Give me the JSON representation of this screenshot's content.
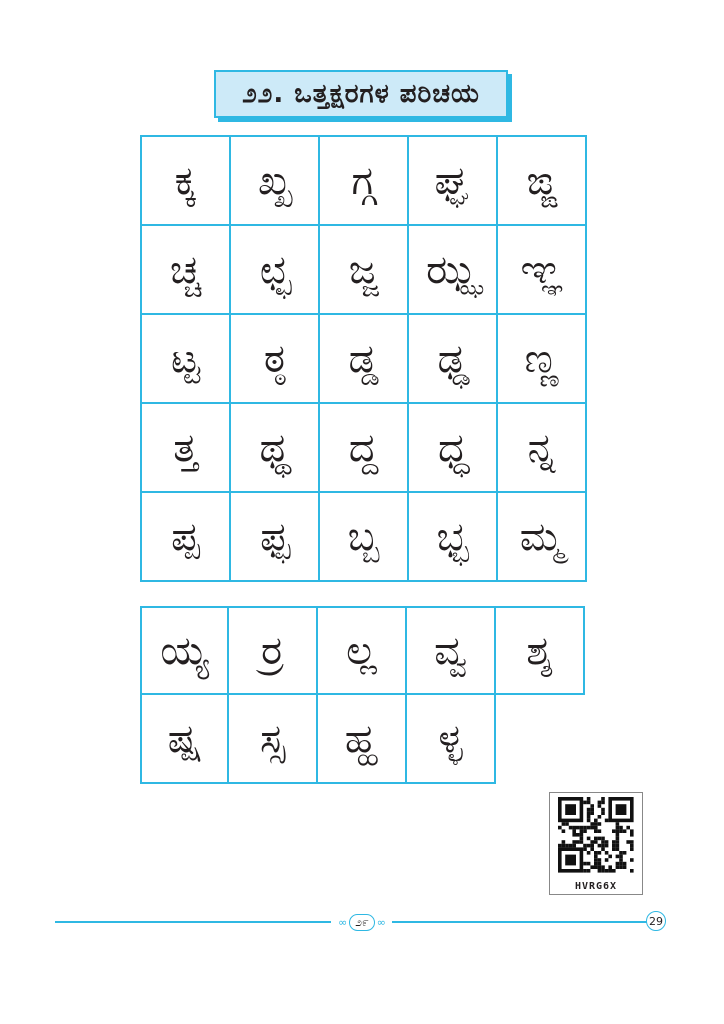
{
  "title": "೨೨. ಒತ್ತಕ್ಷರಗಳ ಪರಿಚಯ",
  "grid_a": [
    [
      "ಕ್ಕ",
      "ಖ್ಖ",
      "ಗ್ಗ",
      "ಘ್ಘ",
      "ಙ್ಙ"
    ],
    [
      "ಚ್ಚ",
      "ಛ್ಛ",
      "ಜ್ಜ",
      "ಝ್ಝ",
      "ಞ್ಞ"
    ],
    [
      "ಟ್ಟ",
      "ಠ್ಠ",
      "ಡ್ಡ",
      "ಢ್ಢ",
      "ಣ್ಣ"
    ],
    [
      "ತ್ತ",
      "ಥ್ಥ",
      "ದ್ದ",
      "ಧ್ಧ",
      "ನ್ನ"
    ],
    [
      "ಪ್ಪ",
      "ಫ್ಫ",
      "ಬ್ಬ",
      "ಭ್ಭ",
      "ಮ್ಮ"
    ]
  ],
  "grid_b": [
    [
      "ಯ್ಯ",
      "ರ್ರ",
      "ಲ್ಲ",
      "ವ್ವ",
      "ಶ್ಶ"
    ],
    [
      "ಷ್ಷ",
      "ಸ್ಸ",
      "ಹ್ಹ",
      "ಳ್ಳ"
    ]
  ],
  "qr": {
    "code": "HVRG6X"
  },
  "footer": {
    "kannada_page": "೨೯",
    "page_number": "29"
  },
  "colors": {
    "accent": "#2fb8e3",
    "title_bg": "#cdeaf8"
  }
}
